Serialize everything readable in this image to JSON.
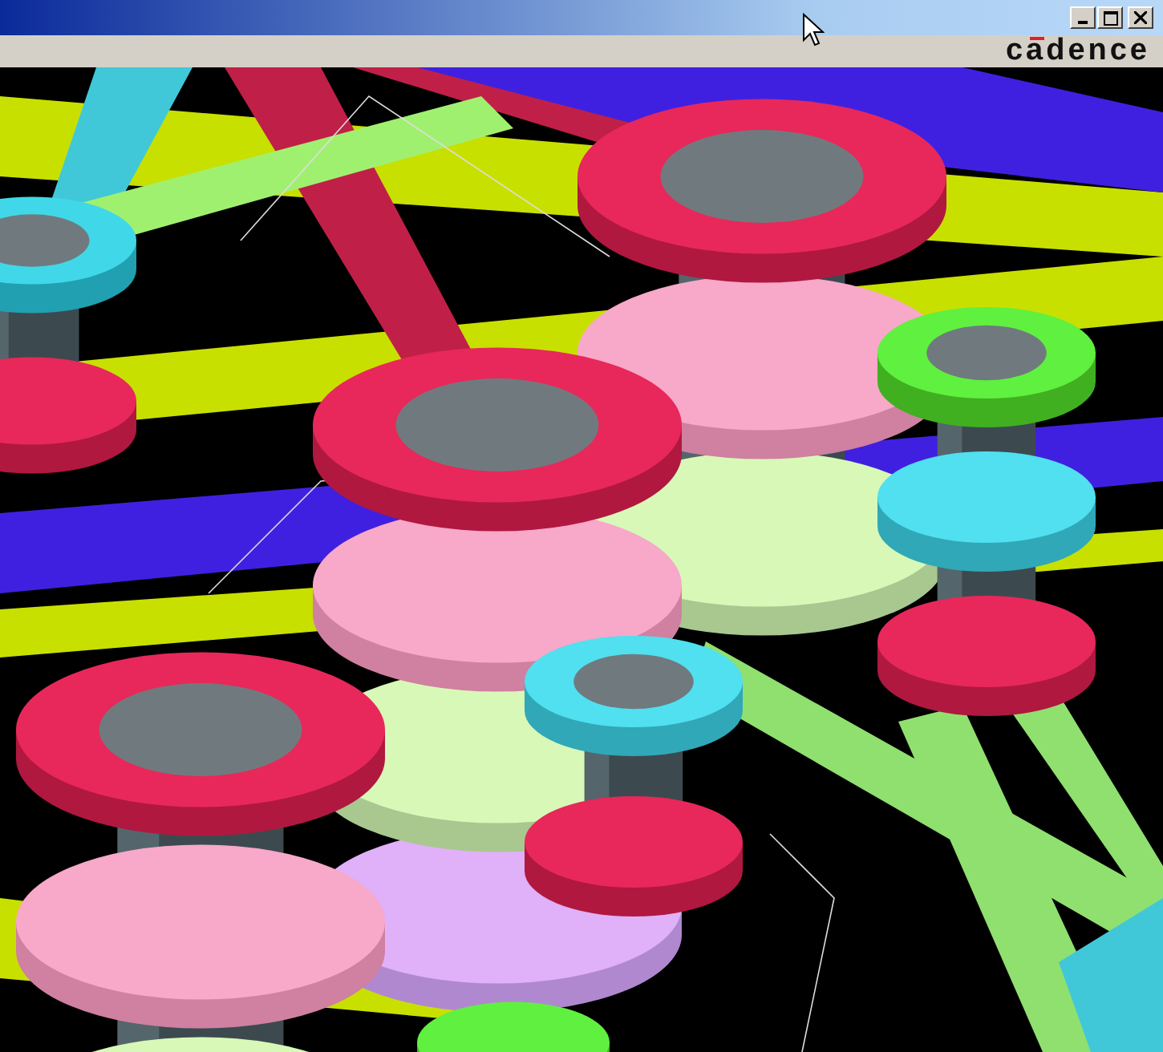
{
  "logo": {
    "text": "cadence"
  }
}
